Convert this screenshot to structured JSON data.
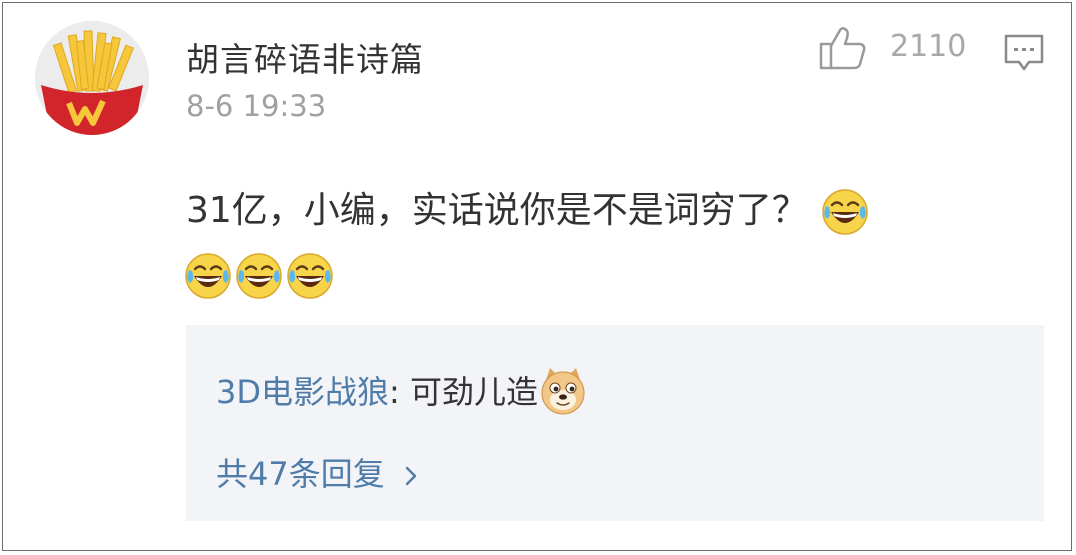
{
  "comment": {
    "username": "胡言碎语非诗篇",
    "timestamp": "8-6 19:33",
    "like_count": "2110",
    "text": "31亿，小编，实话说你是不是词穷了？",
    "emojis": [
      "laugh-cry",
      "laugh-cry",
      "laugh-cry",
      "laugh-cry"
    ]
  },
  "reply": {
    "author": "3D电影战狼",
    "separator": ": ",
    "text": "可劲儿造",
    "emoji": "doge",
    "more_label": "共47条回复"
  },
  "icons": {
    "like": "thumbs-up-icon",
    "comment": "comment-icon",
    "chevron": "chevron-right-icon"
  },
  "colors": {
    "link": "#4f7ca8",
    "muted": "#a0a0a0",
    "reply_bg": "#f3f4f7",
    "avatar_red": "#d2252b",
    "fries_yellow": "#f6c63b"
  }
}
